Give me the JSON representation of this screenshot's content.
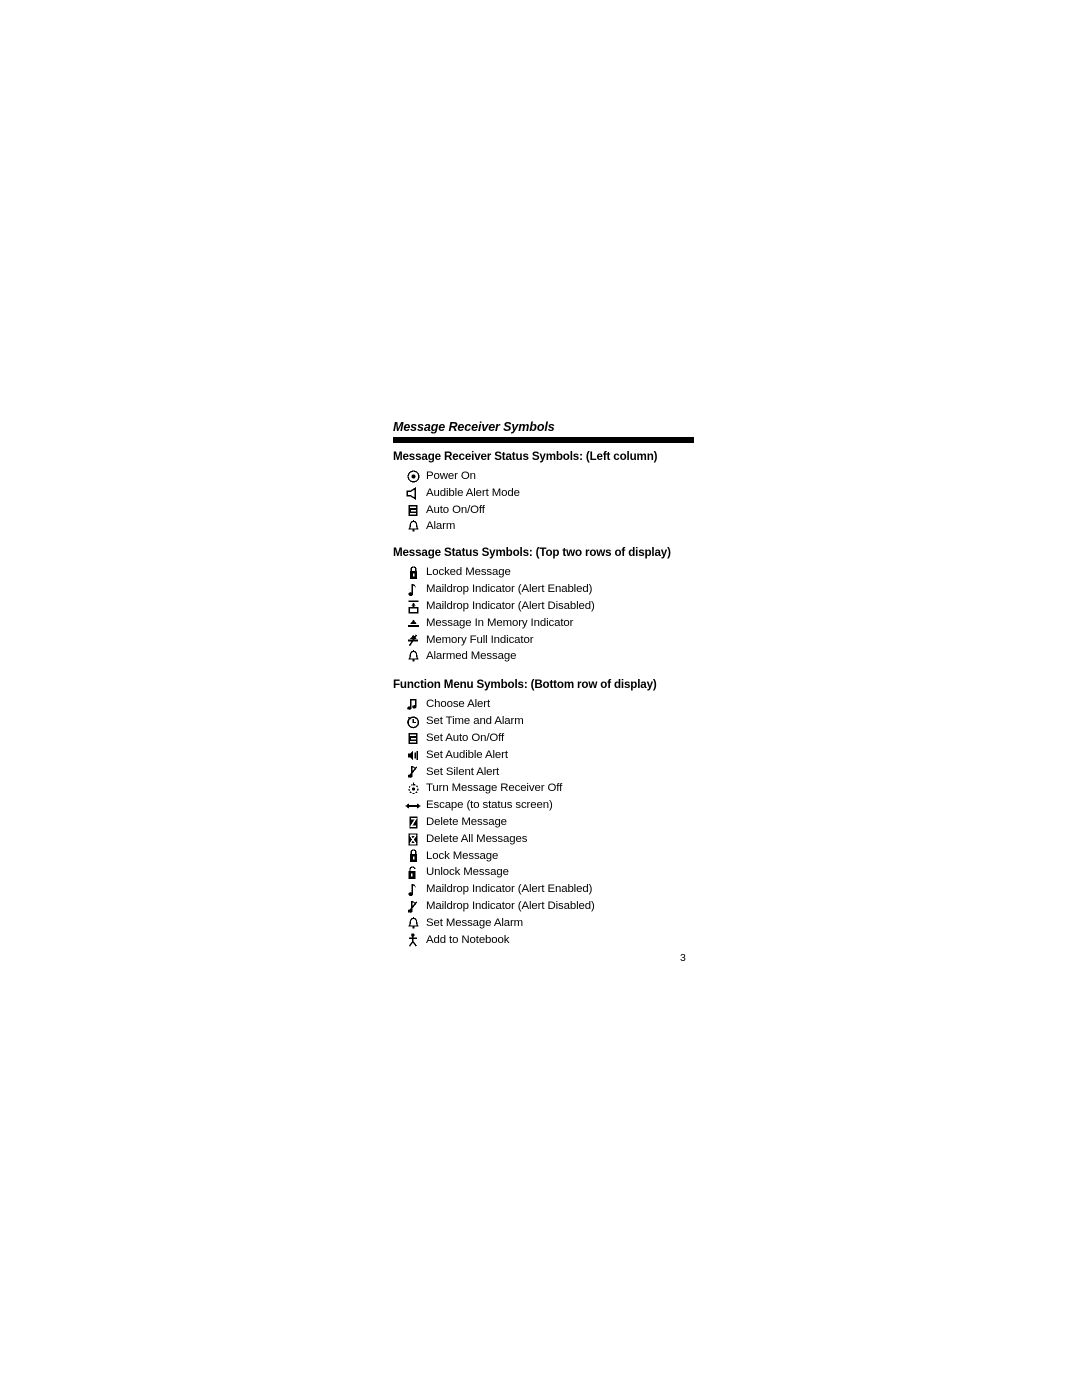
{
  "header": {
    "title": "Message Receiver Symbols"
  },
  "sections": [
    {
      "heading": "Message Receiver Status Symbols: (Left column)",
      "items": [
        {
          "icon": "power-on-icon",
          "label": "Power On"
        },
        {
          "icon": "audible-alert-speaker-icon",
          "label": "Audible Alert Mode"
        },
        {
          "icon": "auto-on-off-icon",
          "label": "Auto On/Off"
        },
        {
          "icon": "alarm-bell-icon",
          "label": "Alarm"
        }
      ]
    },
    {
      "heading": "Message Status Symbols: (Top two rows of display)",
      "items": [
        {
          "icon": "locked-message-padlock-icon",
          "label": "Locked Message"
        },
        {
          "icon": "maildrop-alert-enabled-note-icon",
          "label": "Maildrop Indicator (Alert Enabled)"
        },
        {
          "icon": "maildrop-alert-disabled-mailbox-icon",
          "label": "Maildrop Indicator (Alert Disabled)"
        },
        {
          "icon": "message-in-memory-icon",
          "label": "Message In Memory Indicator"
        },
        {
          "icon": "memory-full-icon",
          "label": "Memory Full Indicator"
        },
        {
          "icon": "alarmed-message-bell-icon",
          "label": "Alarmed Message"
        }
      ]
    },
    {
      "heading": "Function Menu Symbols: (Bottom row of display)",
      "items": [
        {
          "icon": "choose-alert-double-note-icon",
          "label": "Choose Alert"
        },
        {
          "icon": "set-time-alarm-clock-icon",
          "label": "Set Time and Alarm"
        },
        {
          "icon": "set-auto-on-off-icon",
          "label": "Set Auto On/Off"
        },
        {
          "icon": "set-audible-alert-speaker-icon",
          "label": "Set Audible Alert"
        },
        {
          "icon": "set-silent-alert-crossed-note-icon",
          "label": "Set Silent Alert"
        },
        {
          "icon": "turn-receiver-off-power-icon",
          "label": "Turn Message Receiver Off"
        },
        {
          "icon": "escape-double-arrow-icon",
          "label": "Escape (to status screen)"
        },
        {
          "icon": "delete-message-icon",
          "label": "Delete Message"
        },
        {
          "icon": "delete-all-messages-icon",
          "label": "Delete All Messages"
        },
        {
          "icon": "lock-message-padlock-icon",
          "label": "Lock Message"
        },
        {
          "icon": "unlock-message-padlock-icon",
          "label": "Unlock Message"
        },
        {
          "icon": "maildrop-alert-enabled-note-icon",
          "label": "Maildrop Indicator (Alert Enabled)"
        },
        {
          "icon": "maildrop-alert-disabled-crossed-note-icon",
          "label": "Maildrop Indicator (Alert Disabled)"
        },
        {
          "icon": "set-message-alarm-bell-icon",
          "label": "Set Message Alarm"
        },
        {
          "icon": "add-to-notebook-icon",
          "label": "Add to Notebook"
        }
      ]
    }
  ],
  "footer": {
    "page_number": "3"
  },
  "colors": {
    "ink": "#000000",
    "page": "#ffffff"
  }
}
